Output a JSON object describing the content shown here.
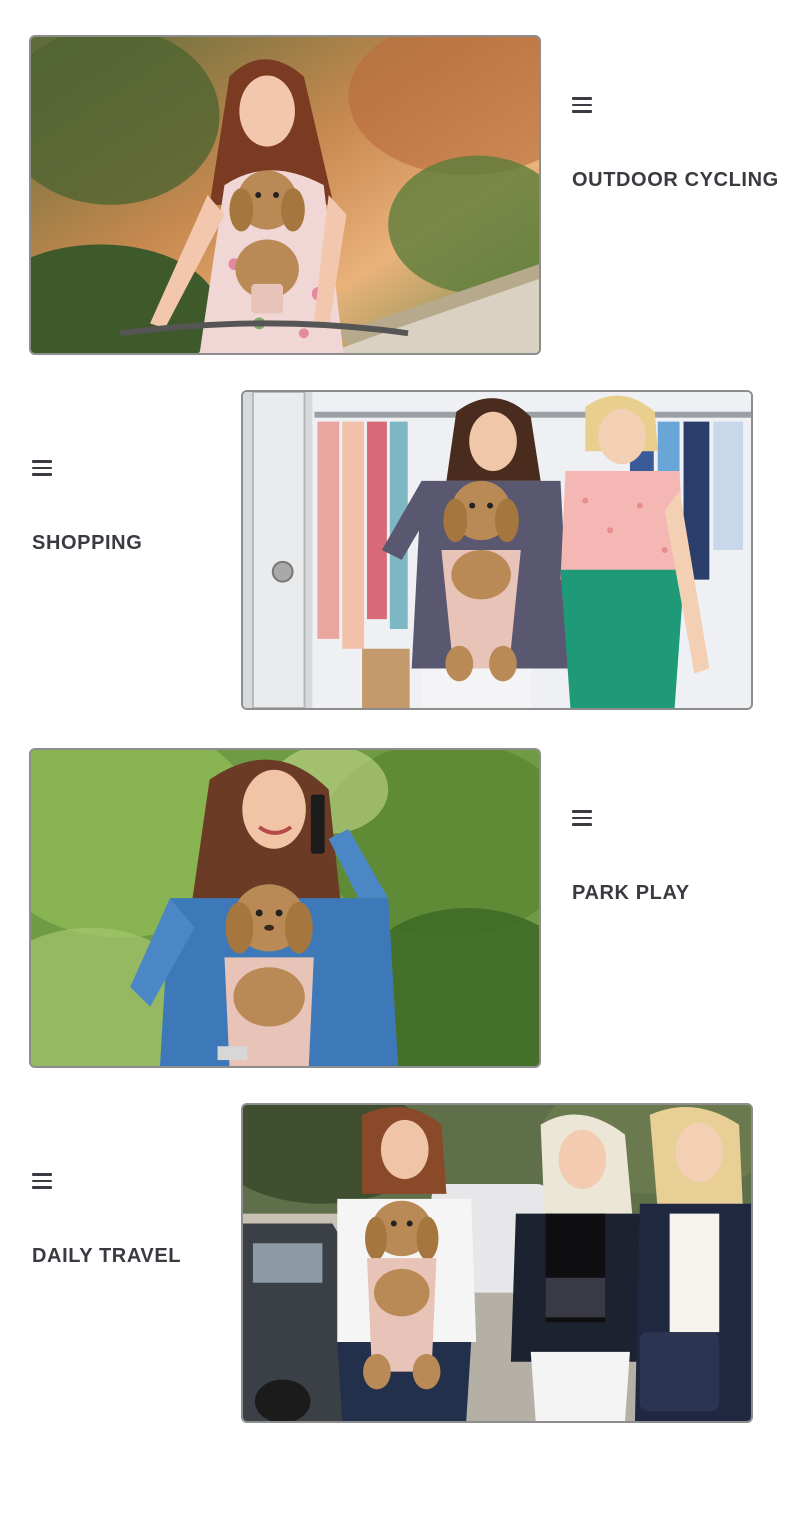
{
  "sections": [
    {
      "label": "OUTDOOR CYCLING",
      "icon": "menu-lines-icon",
      "image": "woman-cycling-with-poodle-in-carrier"
    },
    {
      "label": "SHOPPING",
      "icon": "menu-lines-icon",
      "image": "two-women-shopping-with-poodle-in-carrier"
    },
    {
      "label": "PARK PLAY",
      "icon": "menu-lines-icon",
      "image": "woman-on-phone-with-poodle-in-carrier"
    },
    {
      "label": "DAILY TRAVEL",
      "icon": "menu-lines-icon",
      "image": "three-women-walking-with-poodle-in-carrier"
    }
  ],
  "colors": {
    "text": "#3a3a40",
    "photo_border": "#8d8d8d",
    "poodle": "#b98a55",
    "carrier": "#e8c3b8"
  }
}
